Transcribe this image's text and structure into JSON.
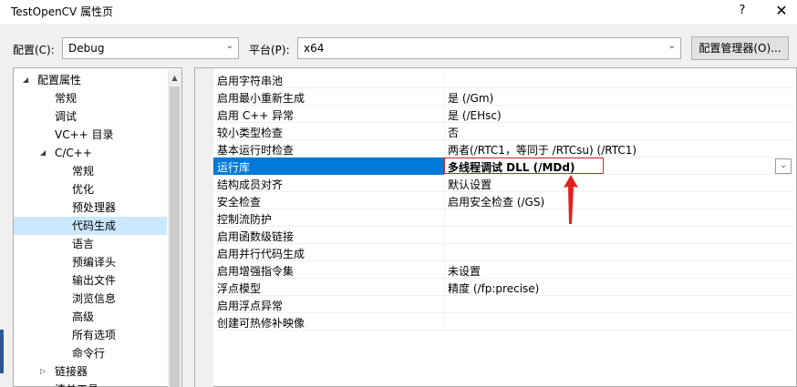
{
  "window": {
    "title": "TestOpenCV 属性页",
    "help_label": "?",
    "close_label": "✕"
  },
  "toolbar": {
    "config_label": "配置(C):",
    "config_value": "Debug",
    "platform_label": "平台(P):",
    "platform_value": "x64",
    "config_manager_label": "配置管理器(O)..."
  },
  "tree": {
    "items": [
      {
        "label": "配置属性",
        "expander": "◢"
      },
      {
        "label": "常规"
      },
      {
        "label": "调试"
      },
      {
        "label": "VC++ 目录"
      },
      {
        "label": "C/C++",
        "expander": "◢"
      },
      {
        "label": "常规"
      },
      {
        "label": "优化"
      },
      {
        "label": "预处理器"
      },
      {
        "label": "代码生成",
        "selected": true
      },
      {
        "label": "语言"
      },
      {
        "label": "预编译头"
      },
      {
        "label": "输出文件"
      },
      {
        "label": "浏览信息"
      },
      {
        "label": "高级"
      },
      {
        "label": "所有选项"
      },
      {
        "label": "命令行"
      },
      {
        "label": "链接器",
        "expander": "▷"
      },
      {
        "label": "清单工具",
        "expander": "▷"
      }
    ]
  },
  "properties": [
    {
      "name": "启用字符串池",
      "value": ""
    },
    {
      "name": "启用最小重新生成",
      "value": "是 (/Gm)"
    },
    {
      "name": "启用 C++ 异常",
      "value": "是 (/EHsc)"
    },
    {
      "name": "较小类型检查",
      "value": "否"
    },
    {
      "name": "基本运行时检查",
      "value": "两者(/RTC1，等同于 /RTCsu) (/RTC1)"
    },
    {
      "name": "运行库",
      "value": "多线程调试 DLL (/MDd)",
      "selected": true
    },
    {
      "name": "结构成员对齐",
      "value": "默认设置"
    },
    {
      "name": "安全检查",
      "value": "启用安全检查 (/GS)"
    },
    {
      "name": "控制流防护",
      "value": ""
    },
    {
      "name": "启用函数级链接",
      "value": ""
    },
    {
      "name": "启用并行代码生成",
      "value": ""
    },
    {
      "name": "启用增强指令集",
      "value": "未设置"
    },
    {
      "name": "浮点模型",
      "value": "精度 (/fp:precise)"
    },
    {
      "name": "启用浮点异常",
      "value": ""
    },
    {
      "name": "创建可热修补映像",
      "value": ""
    }
  ],
  "colors": {
    "selection_blue": "#0078d7",
    "tree_selection": "#cce8ff",
    "annotation_red": "#e02020"
  }
}
